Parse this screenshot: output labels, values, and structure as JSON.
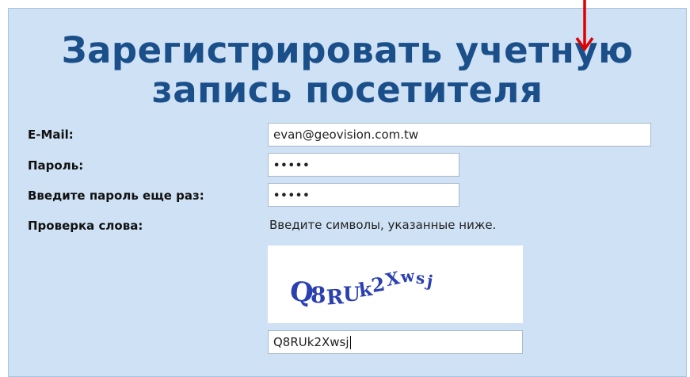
{
  "form": {
    "title_line1": "Зарегистрировать учетную",
    "title_line2": "запись посетителя",
    "email_label": "E-Mail:",
    "email_value": "evan@geovision.com.tw",
    "password_label": "Пароль:",
    "password_value": "•••••",
    "password_confirm_label": "Введите пароль еще раз:",
    "password_confirm_value": "•••••",
    "verify_label": "Проверка слова:",
    "verify_hint": "Введите символы, указанные ниже.",
    "captcha_text": "Q8RUk2Xwsj",
    "captcha_input_value": "Q8RUk2Xwsj"
  },
  "colors": {
    "panel_bg": "#cfe2f5",
    "title": "#1b4f8a",
    "arrow": "#e00000",
    "captcha_ink": "#2a3fb0"
  },
  "icons": {
    "annotation": "red-down-arrow-icon"
  }
}
